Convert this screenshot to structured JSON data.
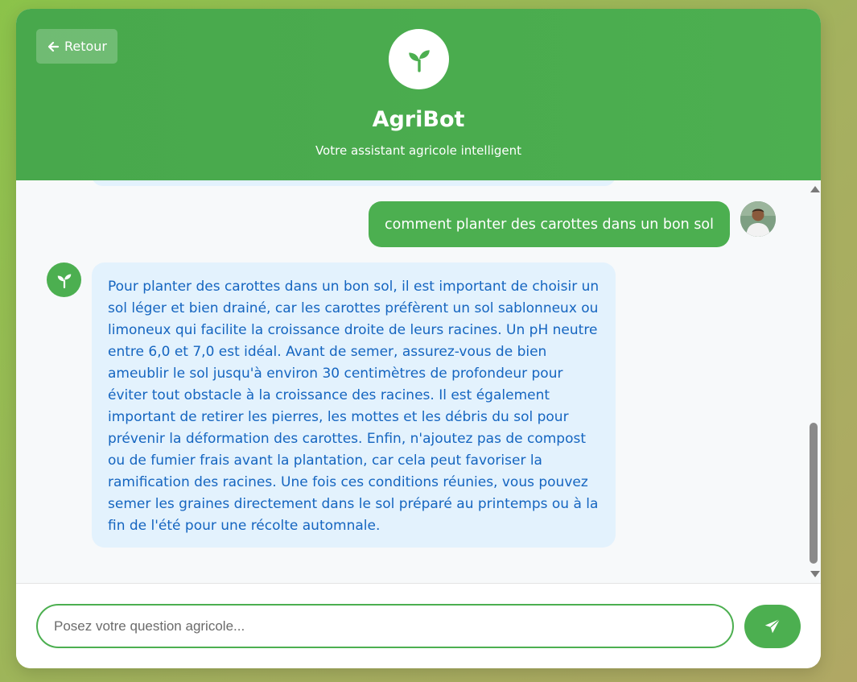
{
  "header": {
    "back_label": "Retour",
    "title": "AgriBot",
    "subtitle": "Votre assistant agricole intelligent",
    "logo_icon": "seedling-icon"
  },
  "messages": [
    {
      "role": "user",
      "text": "comment planter des carottes dans un bon sol"
    },
    {
      "role": "bot",
      "text": "Pour planter des carottes dans un bon sol, il est important de choisir un sol léger et bien drainé, car les carottes préfèrent un sol sablonneux ou limoneux qui facilite la croissance droite de leurs racines. Un pH neutre entre 6,0 et 7,0 est idéal. Avant de semer, assurez-vous de bien ameublir le sol jusqu'à environ 30 centimètres de profondeur pour éviter tout obstacle à la croissance des racines. Il est également important de retirer les pierres, les mottes et les débris du sol pour prévenir la déformation des carottes. Enfin, n'ajoutez pas de compost ou de fumier frais avant la plantation, car cela peut favoriser la ramification des racines. Une fois ces conditions réunies, vous pouvez semer les graines directement dans le sol préparé au printemps ou à la fin de l'été pour une récolte automnale."
    }
  ],
  "input": {
    "placeholder": "Posez votre question agricole...",
    "value": ""
  },
  "icons": {
    "back": "arrow-left-icon",
    "send": "paper-plane-icon",
    "bot_avatar": "seedling-icon"
  },
  "colors": {
    "brand_green": "#4caf50",
    "bot_bubble": "#e3f2fd",
    "bot_text": "#1565c0",
    "chat_background": "#f7f9fa"
  }
}
